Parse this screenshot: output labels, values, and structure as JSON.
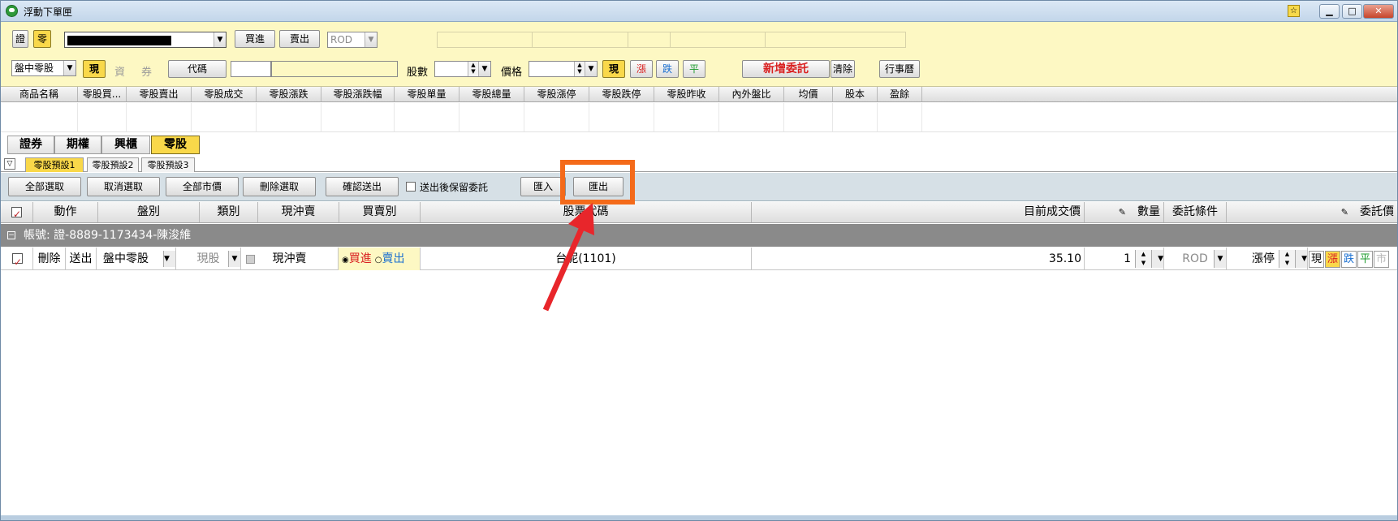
{
  "window": {
    "title": "浮動下單匣",
    "pin": "☆"
  },
  "top": {
    "btn_stock": "證",
    "btn_odd": "零",
    "account_masked": "",
    "btn_buy": "買進",
    "btn_sell": "賣出",
    "order_cond": "ROD",
    "session": "盤中零股",
    "btn_cash": "現",
    "btn_margin": "資",
    "btn_short": "券",
    "btn_code": "代碼",
    "code_value": "",
    "lbl_qty": "股數",
    "lbl_price": "價格",
    "btn_cash2": "現",
    "btn_up": "漲",
    "btn_down": "跌",
    "btn_flat": "平",
    "btn_new_order": "新增委託",
    "btn_clear": "清除",
    "btn_calendar": "行事曆"
  },
  "quote_columns": [
    "商品名稱",
    "零股買...",
    "零股賣出",
    "零股成交",
    "零股漲跌",
    "零股漲跌幅",
    "零股單量",
    "零股總量",
    "零股漲停",
    "零股跌停",
    "零股昨收",
    "內外盤比",
    "均價",
    "股本",
    "盈餘"
  ],
  "tabs": [
    "證券",
    "期權",
    "興櫃",
    "零股"
  ],
  "subtabs": [
    "零股預設1",
    "零股預設2",
    "零股預設3"
  ],
  "toolbar": {
    "select_all": "全部選取",
    "deselect": "取消選取",
    "all_market": "全部市價",
    "delete_selected": "刪除選取",
    "confirm_send": "確認送出",
    "keep_label": "送出後保留委託",
    "import": "匯入",
    "export": "匯出"
  },
  "order_header": {
    "action": "動作",
    "session": "盤別",
    "type": "類別",
    "daytrade": "現沖賣",
    "side": "買賣別",
    "code": "股票代碼",
    "last": "目前成交價",
    "qty": "數量",
    "cond": "委託條件",
    "price": "委託價"
  },
  "account_label": "帳號: 證-8889-1173434-陳浚維",
  "order_row": {
    "delete": "刪除",
    "send": "送出",
    "session": "盤中零股",
    "type": "現股",
    "daytrade": "現沖賣",
    "buy": "買進",
    "sell": "賣出",
    "code": "台泥(1101)",
    "last": "35.10",
    "qty": "1",
    "cond": "ROD",
    "price": "漲停",
    "p_cash": "現",
    "p_up": "漲",
    "p_down": "跌",
    "p_flat": "平",
    "p_mkt": "市"
  },
  "colors": {
    "accent_yellow": "#f9d84a",
    "highlight_orange": "#f46a1a",
    "arrow_red": "#e8262b",
    "top_bg": "#fdf8c3"
  }
}
